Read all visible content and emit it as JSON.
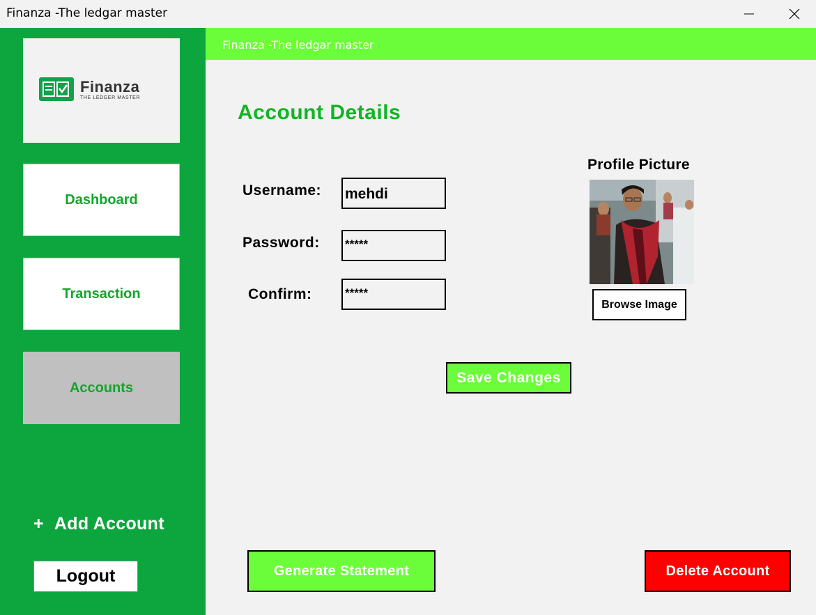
{
  "window": {
    "title": "Finanza -The ledgar master"
  },
  "header": {
    "title": "Finanza -The ledgar master"
  },
  "logo": {
    "name": "Finanza",
    "tagline": "THE LEDGER MASTER"
  },
  "sidebar": {
    "items": [
      {
        "label": "Dashboard",
        "active": false
      },
      {
        "label": "Transaction",
        "active": false
      },
      {
        "label": "Accounts",
        "active": true
      }
    ],
    "add_account_icon": "+",
    "add_account_label": "Add Account",
    "logout_label": "Logout"
  },
  "main": {
    "page_title": "Account Details",
    "form": {
      "username_label": "Username:",
      "username_value": "mehdi",
      "password_label": "Password:",
      "password_value": "*****",
      "confirm_label": "Confirm:",
      "confirm_value": "*****"
    },
    "profile": {
      "label": "Profile Picture",
      "browse_label": "Browse Image"
    },
    "save_label": "Save Changes",
    "generate_label": "Generate Statement",
    "delete_label": "Delete Account"
  },
  "colors": {
    "sidebar_bg": "#0da63e",
    "header_bg": "#6cfd3a",
    "accent_green_text": "#12b424",
    "delete_red": "#ff0000",
    "active_nav_bg": "#c0c0c0"
  },
  "icons": {
    "minimize": "minimize-icon",
    "close": "close-icon",
    "add": "plus-icon"
  }
}
